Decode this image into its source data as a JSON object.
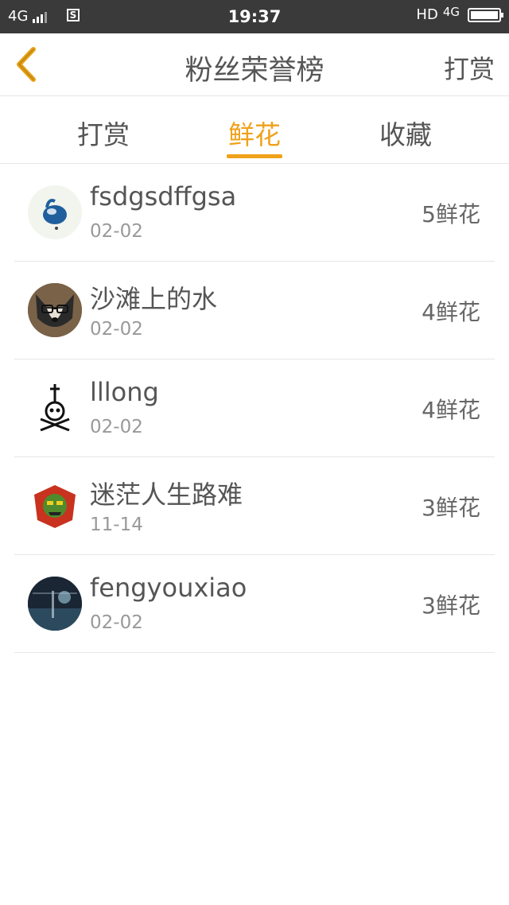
{
  "status_bar": {
    "network_left": "4G",
    "time": "19:37",
    "network_right": "HD",
    "network_right_super": "4G"
  },
  "header": {
    "title": "粉丝荣誉榜",
    "action_label": "打赏"
  },
  "tabs": [
    {
      "label": "打赏",
      "active": false
    },
    {
      "label": "鲜花",
      "active": true
    },
    {
      "label": "收藏",
      "active": false
    }
  ],
  "fans": [
    {
      "name": "fsdgsdffgsa",
      "date": "02-02",
      "count": "5鲜花"
    },
    {
      "name": "沙滩上的水",
      "date": "02-02",
      "count": "4鲜花"
    },
    {
      "name": "lllong",
      "date": "02-02",
      "count": "4鲜花"
    },
    {
      "name": "迷茫人生路难",
      "date": "11-14",
      "count": "3鲜花"
    },
    {
      "name": "fengyouxiao",
      "date": "02-02",
      "count": "3鲜花"
    }
  ],
  "colors": {
    "accent": "#f0a11a",
    "statusbar": "#3a3a3a",
    "text": "#555555",
    "subtext": "#999999"
  }
}
